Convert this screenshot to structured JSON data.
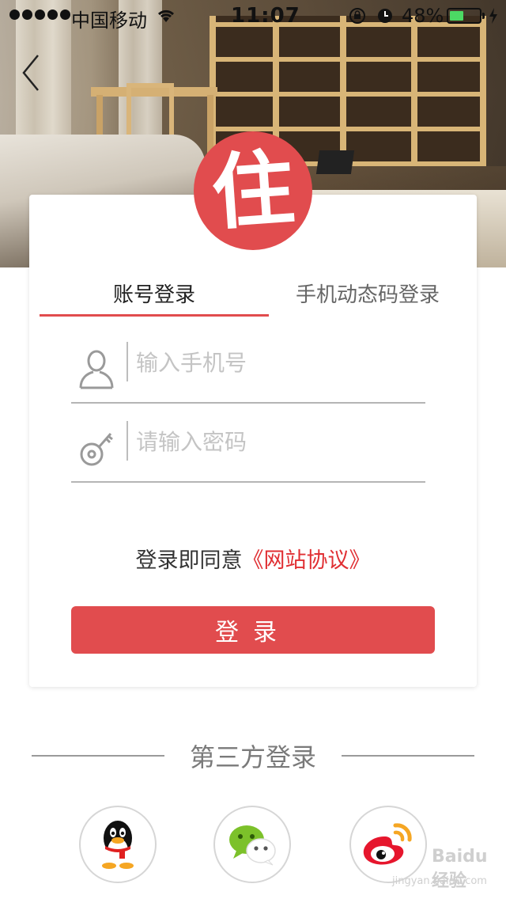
{
  "status_bar": {
    "carrier": "中国移动",
    "time": "11:07",
    "battery_percent": "48%",
    "battery_level": 0.48,
    "battery_color": "#4cd964"
  },
  "navigation": {
    "back_icon": "chevron-left-icon"
  },
  "logo": {
    "text": "住",
    "color": "#e14c4e"
  },
  "tabs": [
    {
      "label": "账号登录",
      "active": true
    },
    {
      "label": "手机动态码登录",
      "active": false
    }
  ],
  "form": {
    "phone": {
      "value": "",
      "placeholder": "输入手机号",
      "icon": "user-icon"
    },
    "password": {
      "value": "",
      "placeholder": "请输入密码",
      "icon": "key-icon"
    }
  },
  "agreement": {
    "prefix": "登录即同意",
    "link": "《网站协议》"
  },
  "login_button": {
    "label": "登录"
  },
  "third_party": {
    "title": "第三方登录",
    "providers": [
      {
        "name": "qq",
        "icon": "qq-icon"
      },
      {
        "name": "wechat",
        "icon": "wechat-icon"
      },
      {
        "name": "weibo",
        "icon": "weibo-icon"
      }
    ]
  },
  "watermark": {
    "logo": "Baidu经验",
    "url": "jingyan.baidu.com"
  },
  "colors": {
    "accent": "#e14c4e",
    "link": "#e02f33"
  }
}
